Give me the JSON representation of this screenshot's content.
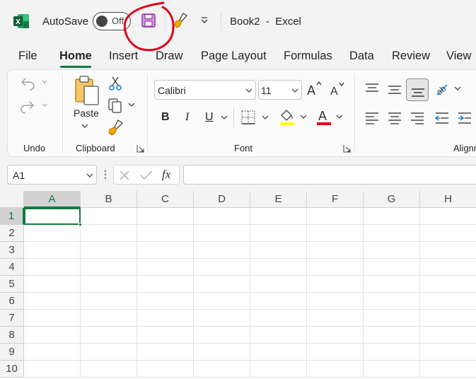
{
  "title_bar": {
    "autosave_label": "AutoSave",
    "autosave_state": "Off",
    "document_title": "Book2  -  Excel",
    "app_icon": "excel-icon",
    "save_icon": "save-icon",
    "painter_icon": "format-painter-icon",
    "customize_icon": "chevron-down-icon",
    "annotation_color": "#e0001a"
  },
  "ribbon_tabs": [
    {
      "label": "File",
      "active": false
    },
    {
      "label": "Home",
      "active": true
    },
    {
      "label": "Insert",
      "active": false
    },
    {
      "label": "Draw",
      "active": false
    },
    {
      "label": "Page Layout",
      "active": false
    },
    {
      "label": "Formulas",
      "active": false
    },
    {
      "label": "Data",
      "active": false
    },
    {
      "label": "Review",
      "active": false
    },
    {
      "label": "View",
      "active": false
    }
  ],
  "groups": {
    "undo": {
      "label": "Undo"
    },
    "clipboard": {
      "label": "Clipboard",
      "paste_label": "Paste"
    },
    "font": {
      "label": "Font",
      "font_name": "Calibri",
      "font_size": "11",
      "bold": "B",
      "italic": "I",
      "underline": "U",
      "highlight_color": "#ffff00",
      "font_color": "#e0001a"
    },
    "alignment": {
      "label": "Alignm"
    }
  },
  "formula_bar": {
    "name_box": "A1",
    "cancel_icon": "cancel-icon",
    "enter_icon": "checkmark-icon",
    "fx_label": "fx",
    "formula_value": ""
  },
  "grid": {
    "columns": [
      "A",
      "B",
      "C",
      "D",
      "E",
      "F",
      "G",
      "H"
    ],
    "rows": [
      "1",
      "2",
      "3",
      "4",
      "5",
      "6",
      "7",
      "8",
      "9",
      "10"
    ],
    "active_cell": "A1"
  },
  "colors": {
    "accent": "#107c41",
    "excel_green": "#107c41",
    "save_magenta": "#b146c2"
  }
}
